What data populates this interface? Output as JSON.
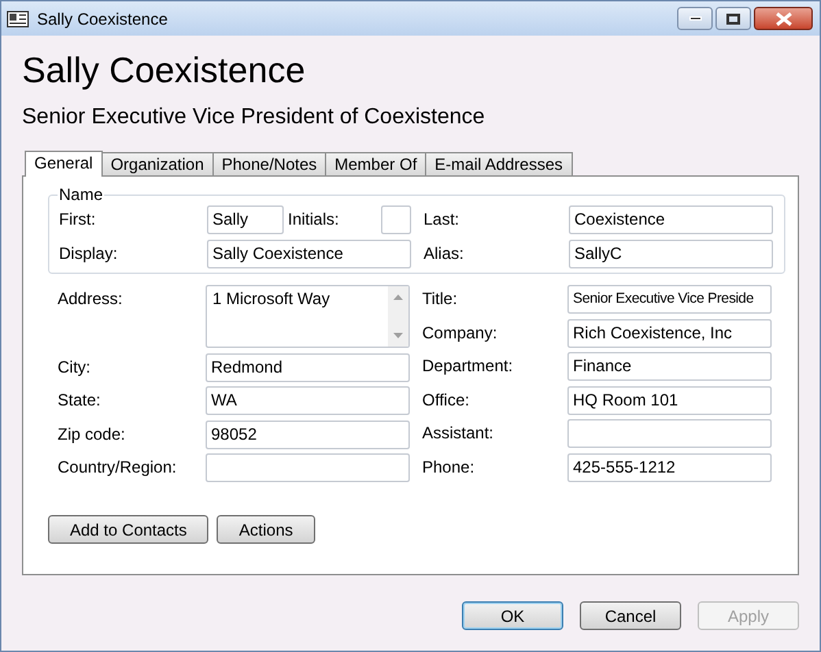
{
  "window": {
    "title": "Sally Coexistence"
  },
  "header": {
    "name": "Sally Coexistence",
    "job_title": "Senior Executive Vice President of Coexistence"
  },
  "tabs": [
    {
      "label": "General",
      "selected": true
    },
    {
      "label": "Organization",
      "selected": false
    },
    {
      "label": "Phone/Notes",
      "selected": false
    },
    {
      "label": "Member Of",
      "selected": false
    },
    {
      "label": "E-mail Addresses",
      "selected": false
    }
  ],
  "name_group": {
    "label": "Name",
    "first": {
      "label": "First:",
      "value": "Sally"
    },
    "initials": {
      "label": "Initials:"
    },
    "last": {
      "label": "Last:",
      "value": "Coexistence"
    },
    "display": {
      "label": "Display:",
      "value": "Sally Coexistence"
    },
    "alias": {
      "label": "Alias:",
      "value": "SallyC"
    }
  },
  "left_fields": [
    {
      "label": "Address:",
      "value": "1 Microsoft Way",
      "kind": "multiline"
    },
    {
      "label": "City:",
      "value": "Redmond",
      "kind": "single"
    },
    {
      "label": "State:",
      "value": "WA",
      "kind": "single"
    },
    {
      "label": "Zip code:",
      "value": "98052",
      "kind": "single"
    },
    {
      "label": "Country/Region:",
      "kind": "single"
    }
  ],
  "right_fields": [
    {
      "label": "Title:",
      "value": "Senior Executive Vice Preside"
    },
    {
      "label": "Company:",
      "value": "Rich Coexistence, Inc"
    },
    {
      "label": "Department:",
      "value": "Finance"
    },
    {
      "label": "Office:",
      "value": "HQ Room 101"
    },
    {
      "label": "Assistant:"
    },
    {
      "label": "Phone:",
      "value": "425-555-1212"
    }
  ],
  "panel_buttons": [
    "Add to Contacts",
    "Actions"
  ],
  "dialog_buttons": [
    {
      "label": "OK",
      "default": true,
      "disabled": false
    },
    {
      "label": "Cancel",
      "default": false,
      "disabled": false
    },
    {
      "label": "Apply",
      "default": false,
      "disabled": true
    }
  ]
}
